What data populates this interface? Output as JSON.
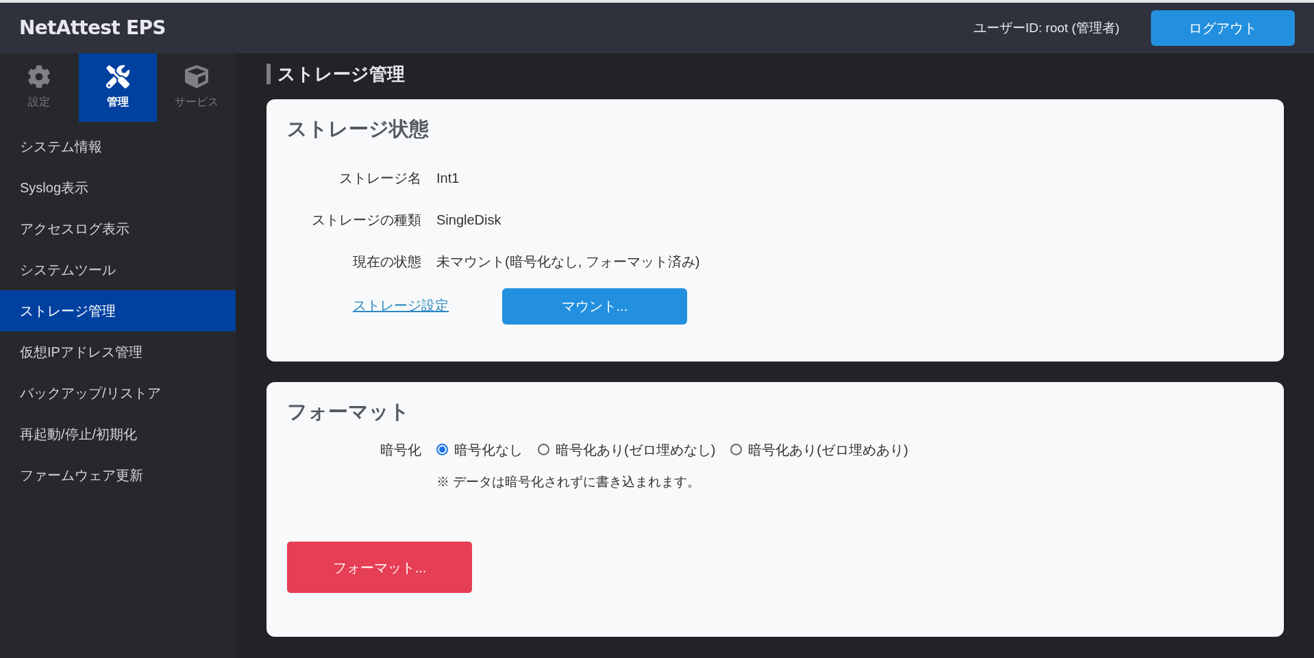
{
  "header": {
    "logo": "NetAttest EPS",
    "user": "ユーザーID: root (管理者)",
    "logout": "ログアウト"
  },
  "tabs": [
    {
      "kind": "gear",
      "label": "設定",
      "selected": false
    },
    {
      "kind": "tools",
      "label": "管理",
      "selected": true
    },
    {
      "kind": "cube",
      "label": "サービス",
      "selected": false
    }
  ],
  "sidebar": {
    "items": [
      {
        "label": "システム情報",
        "selected": false
      },
      {
        "label": "Syslog表示",
        "selected": false
      },
      {
        "label": "アクセスログ表示",
        "selected": false
      },
      {
        "label": "システムツール",
        "selected": false
      },
      {
        "label": "ストレージ管理",
        "selected": true
      },
      {
        "label": "仮想IPアドレス管理",
        "selected": false
      },
      {
        "label": "バックアップ/リストア",
        "selected": false
      },
      {
        "label": "再起動/停止/初期化",
        "selected": false
      },
      {
        "label": "ファームウェア更新",
        "selected": false
      }
    ]
  },
  "page_title": "ストレージ管理",
  "status_card": {
    "title": "ストレージ状態",
    "fields": [
      {
        "label": "ストレージ名",
        "value": "Int1"
      },
      {
        "label": "ストレージの種類",
        "value": "SingleDisk"
      },
      {
        "label": "現在の状態",
        "value": "未マウント(暗号化なし, フォーマット済み)"
      }
    ],
    "link": "ストレージ設定",
    "button": "マウント..."
  },
  "format_card": {
    "title": "フォーマット",
    "label": "暗号化",
    "options": [
      {
        "label": "暗号化なし",
        "selected": true
      },
      {
        "label": "暗号化あり(ゼロ埋めなし)",
        "selected": false
      },
      {
        "label": "暗号化あり(ゼロ埋めあり)",
        "selected": false
      }
    ],
    "note": "※ データは暗号化されずに書き込まれます。",
    "button": "フォーマット..."
  }
}
